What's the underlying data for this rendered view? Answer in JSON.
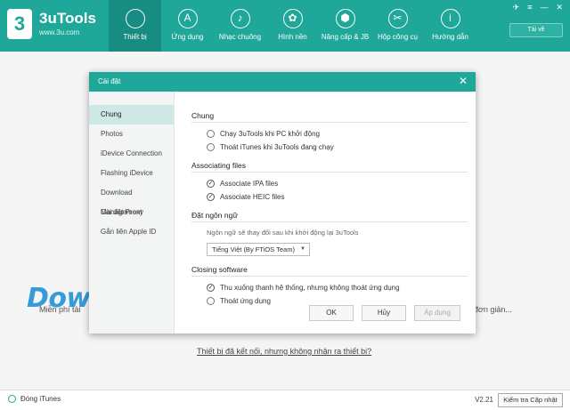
{
  "app": {
    "name": "3uTools",
    "site": "www.3u.com",
    "logo_glyph": "3"
  },
  "window": {
    "download_label": "Tải về",
    "controls": [
      "✈",
      "≡",
      "—",
      "✕"
    ]
  },
  "nav": [
    {
      "label": "Thiết bị",
      "icon": "apple-icon",
      "glyph": "",
      "active": true
    },
    {
      "label": "Ứng dụng",
      "icon": "appstore-icon",
      "glyph": "A",
      "active": false
    },
    {
      "label": "Nhạc chuông",
      "icon": "bell-icon",
      "glyph": "♪",
      "active": false
    },
    {
      "label": "Hình nền",
      "icon": "flower-icon",
      "glyph": "✿",
      "active": false
    },
    {
      "label": "Nâng cấp & JB",
      "icon": "box-icon",
      "glyph": "⬢",
      "active": false
    },
    {
      "label": "Hộp công cụ",
      "icon": "tools-icon",
      "glyph": "✂",
      "active": false
    },
    {
      "label": "Hướng dẫn",
      "icon": "info-icon",
      "glyph": "i",
      "active": false
    }
  ],
  "background": {
    "left_text": "Miễn phí tải",
    "right_text": "ch đơn giản...",
    "link_text": "Thiết bị đã kết nối, nhưng không nhận ra thiết bị?",
    "watermark": "Download.com.vn",
    "dot_colors": [
      "#7cc8ec",
      "#cfcfcf",
      "#aedb82",
      "#f6cf6d",
      "#5ea2de",
      "#ee7d84"
    ]
  },
  "dialog": {
    "title": "Cài đặt",
    "close": "✕",
    "sidebar": [
      "Chung",
      "Photos",
      "iDevice Connection",
      "Flashing iDevice",
      "Download Management",
      "Cài đặt Proxy",
      "Gắn liên Apple ID"
    ],
    "sections": {
      "general": {
        "title": "Chung",
        "opt1": "Chạy 3uTools khi PC khởi động",
        "opt2": "Thoát iTunes khi 3uTools đang chạy"
      },
      "assoc": {
        "title": "Associating files",
        "opt1": "Associate IPA files",
        "opt2": "Associate HEIC files"
      },
      "lang": {
        "title": "Đặt ngôn ngữ",
        "note": "Ngôn ngữ sẽ thay đổi sau khi khởi động lại 3uTools",
        "selected": "Tiếng Việt (By FTiOS Team)"
      },
      "closing": {
        "title": "Closing software",
        "opt1": "Thu xuống thanh hệ thống, nhưng không thoát ứng dụng",
        "opt2": "Thoát ứng dụng"
      }
    },
    "buttons": {
      "ok": "OK",
      "cancel": "Hủy",
      "apply": "Áp dụng"
    }
  },
  "footer": {
    "itunes": "Đóng iTunes",
    "version": "V2.21",
    "update": "Kiểm tra Cập nhật"
  }
}
